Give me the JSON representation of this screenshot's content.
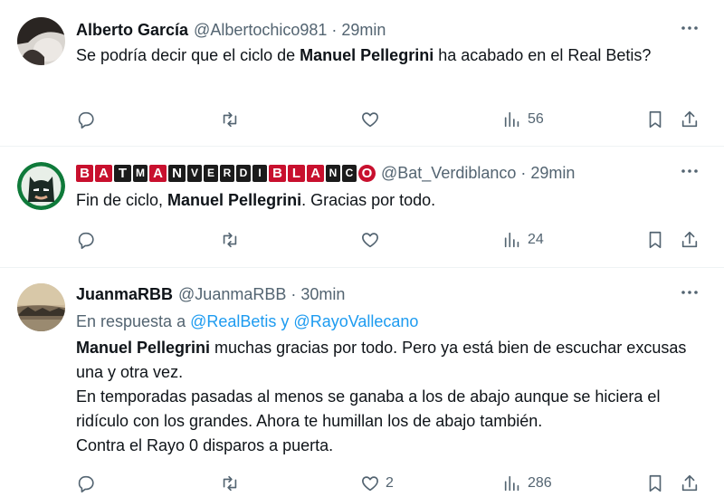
{
  "tweets": [
    {
      "author": "Alberto García",
      "handle": "@Albertochico981",
      "dot": "·",
      "time": "29min",
      "text_parts": [
        "Se podría decir que el ciclo de ",
        "Manuel Pellegrini",
        " ha acabado en el Real Betis?"
      ],
      "views": "56",
      "likes": ""
    },
    {
      "author_boxes": [
        "B",
        "A",
        "T",
        "M",
        "A",
        "N",
        "V",
        "E",
        "R",
        "D",
        "I",
        "B",
        "L",
        "A",
        "N",
        "C",
        "O"
      ],
      "handle": "@Bat_Verdiblanco",
      "dot": "·",
      "time": "29min",
      "text_parts": [
        "Fin de ciclo, ",
        "Manuel Pellegrini",
        ". Gracias por todo."
      ],
      "views": "24",
      "likes": ""
    },
    {
      "author": "JuanmaRBB",
      "handle": "@JuanmaRBB",
      "dot": "·",
      "time": "30min",
      "reply_prefix": "En respuesta a ",
      "reply_to_1": "@RealBetis",
      "reply_and": " y ",
      "reply_to_2": "@RayoVallecano",
      "text_bold": "Manuel Pellegrini",
      "text_line1": " muchas gracias por todo. Pero ya está bien de escuchar excusas una y otra vez.",
      "text_line2": "En temporadas pasadas al menos se ganaba a los de abajo aunque se hiciera el ridículo con los grandes. Ahora te humillan los de abajo también.",
      "text_line3": "Contra el Rayo 0 disparos a puerta.",
      "views": "286",
      "likes": "2"
    }
  ],
  "icons": {
    "more": "more-icon",
    "reply": "reply-icon",
    "retweet": "retweet-icon",
    "like": "heart-icon",
    "views": "views-icon",
    "bookmark": "bookmark-icon",
    "share": "share-icon"
  },
  "colors": {
    "text": "#0f1419",
    "secondary": "#536471",
    "link": "#1d9bf0",
    "brand_red": "#c8102e"
  }
}
